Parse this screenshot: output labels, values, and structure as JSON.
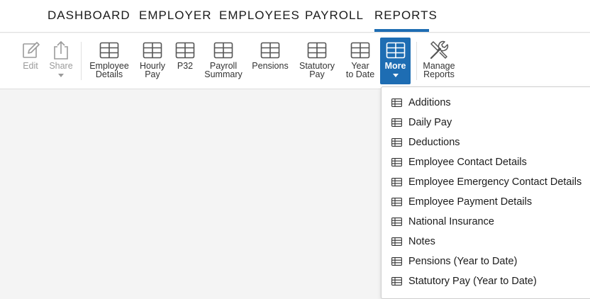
{
  "topnav": {
    "items": [
      {
        "label": "DASHBOARD"
      },
      {
        "label": "EMPLOYER"
      },
      {
        "label": "EMPLOYEES"
      },
      {
        "label": "PAYROLL"
      },
      {
        "label": "REPORTS"
      }
    ],
    "active": "REPORTS"
  },
  "toolbar": {
    "edit": {
      "label": "Edit",
      "icon": "edit-icon",
      "state": "disabled"
    },
    "share": {
      "label": "Share",
      "icon": "share-icon",
      "state": "disabled"
    },
    "reports": [
      {
        "label": "Employee\nDetails",
        "icon": "table-icon"
      },
      {
        "label": "Hourly\nPay",
        "icon": "table-icon"
      },
      {
        "label": "P32",
        "icon": "table-icon"
      },
      {
        "label": "Payroll\nSummary",
        "icon": "table-icon"
      },
      {
        "label": "Pensions",
        "icon": "table-icon"
      },
      {
        "label": "Statutory\nPay",
        "icon": "table-icon"
      },
      {
        "label": "Year\nto Date",
        "icon": "table-icon"
      }
    ],
    "more": {
      "label": "More",
      "icon": "table-icon",
      "state": "active"
    },
    "manage": {
      "label": "Manage\nReports",
      "icon": "tools-icon"
    }
  },
  "more_menu": {
    "items": [
      {
        "label": "Additions"
      },
      {
        "label": "Daily Pay"
      },
      {
        "label": "Deductions"
      },
      {
        "label": "Employee Contact Details"
      },
      {
        "label": "Employee Emergency Contact Details"
      },
      {
        "label": "Employee Payment Details"
      },
      {
        "label": "National Insurance"
      },
      {
        "label": "Notes"
      },
      {
        "label": "Pensions (Year to Date)"
      },
      {
        "label": "Statutory Pay (Year to Date)"
      }
    ]
  },
  "colors": {
    "accent": "#1e6db3",
    "text": "#1b1b1b",
    "disabled": "#9b9b9b",
    "background": "#f4f4f4"
  }
}
